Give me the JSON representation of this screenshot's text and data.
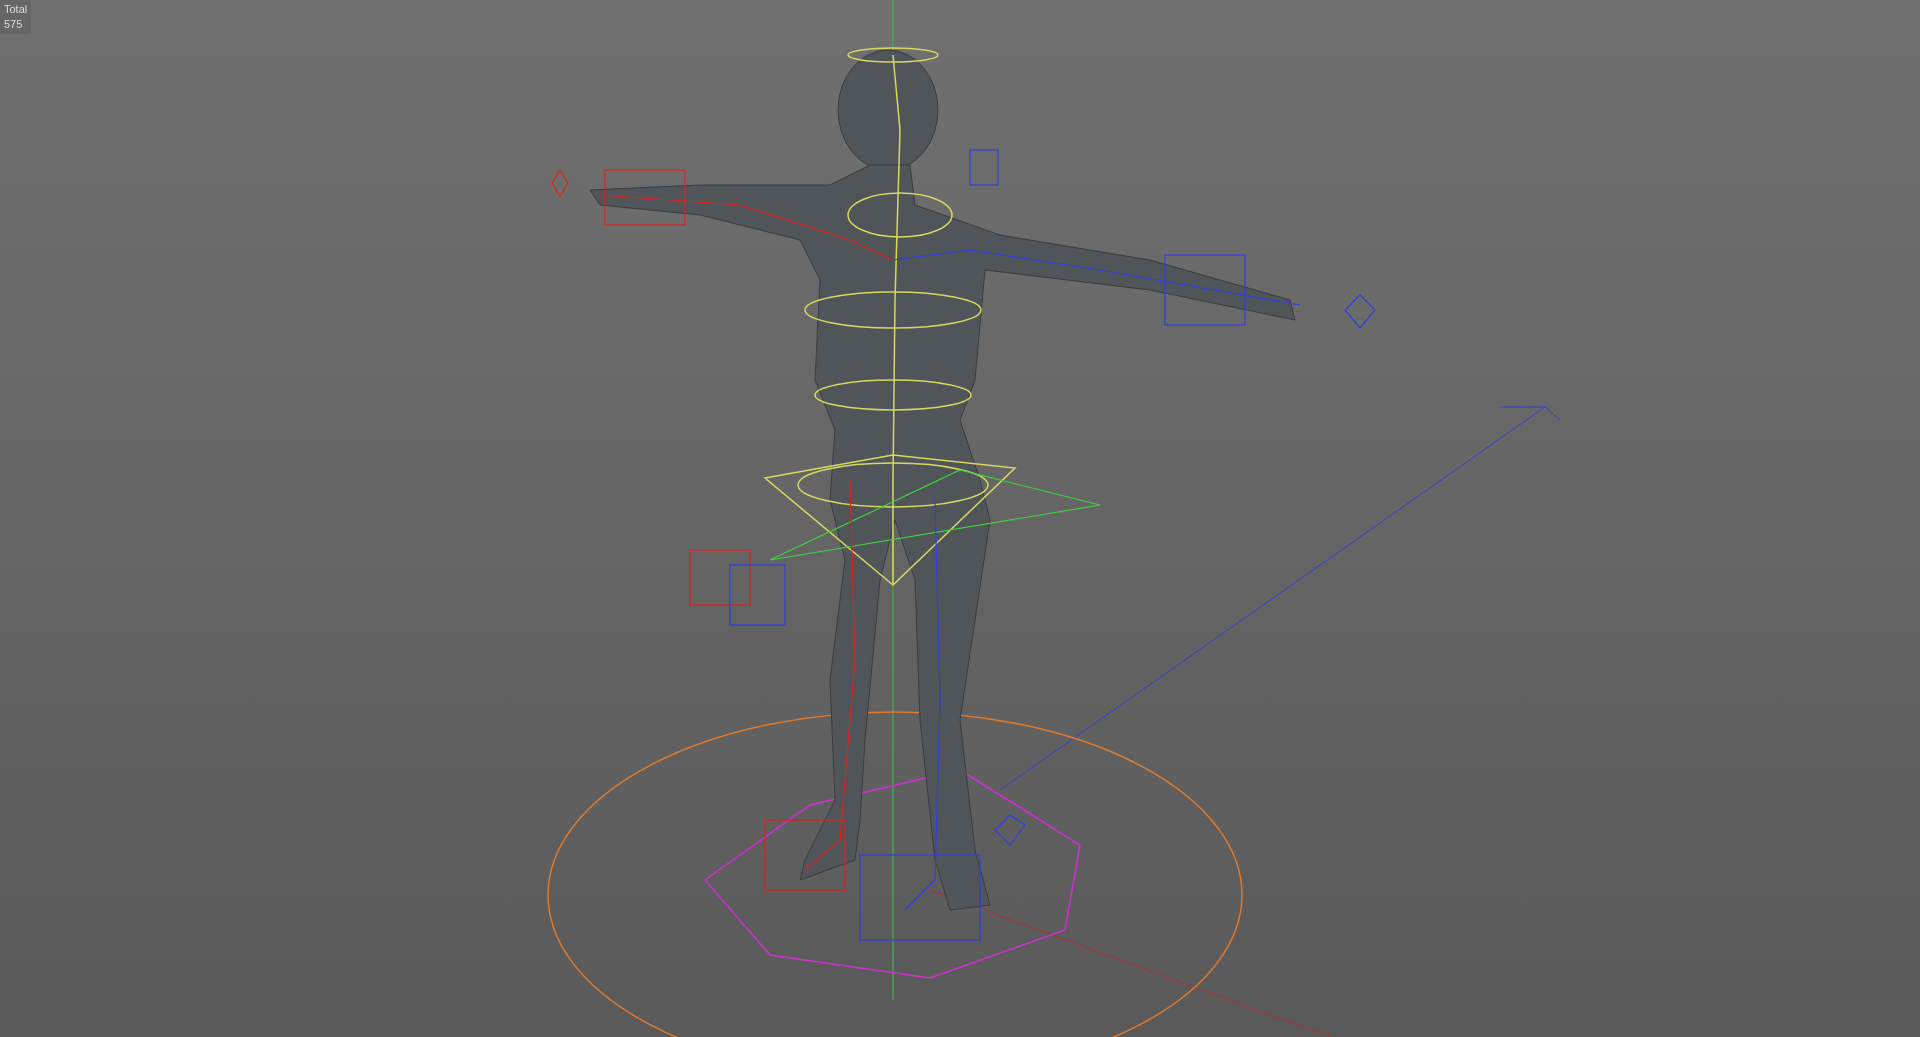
{
  "viewport": {
    "stats": {
      "label": "Total",
      "value": "575"
    }
  }
}
